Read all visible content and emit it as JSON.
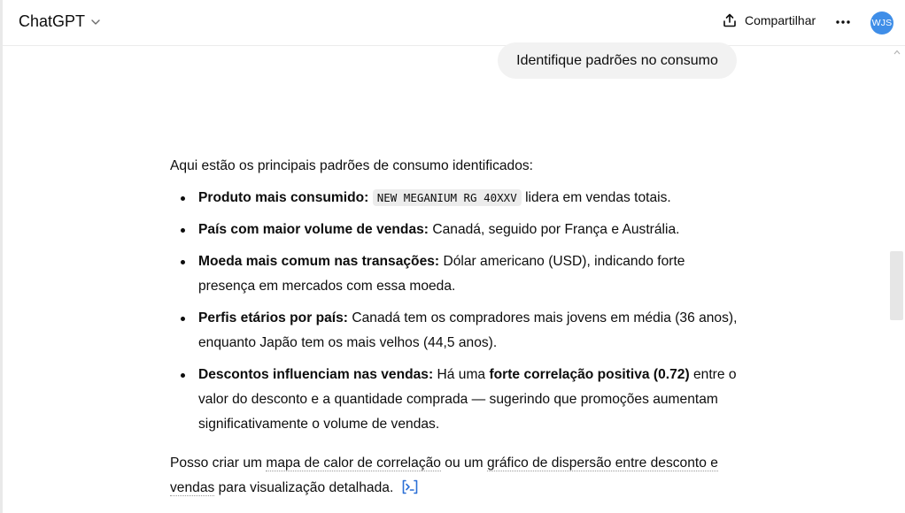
{
  "header": {
    "model_name": "ChatGPT",
    "share_label": "Compartilhar",
    "avatar_initials": "WJS",
    "avatar_color": "#3f8ee8"
  },
  "user_message": {
    "text": "Identifique padrões no consumo"
  },
  "assistant": {
    "intro": "Aqui estão os principais padrões de consumo identificados:",
    "bullets": [
      {
        "bold": "Produto mais consumido:",
        "code": "NEW MEGANIUM RG 40XXV",
        "rest": " lidera em vendas totais."
      },
      {
        "bold": "País com maior volume de vendas:",
        "rest": " Canadá, seguido por França e Austrália."
      },
      {
        "bold": "Moeda mais comum nas transações:",
        "rest": " Dólar americano (USD), indicando forte presença em mercados com essa moeda."
      },
      {
        "bold": "Perfis etários por país:",
        "rest": " Canadá tem os compradores mais jovens em média (36 anos), enquanto Japão tem os mais velhos (44,5 anos)."
      },
      {
        "bold": "Descontos influenciam nas vendas:",
        "rest_a": " Há uma ",
        "bold2": "forte correlação positiva (0.72)",
        "rest_b": " entre o valor do desconto e a quantidade comprada — sugerindo que promoções aumentam significativamente o volume de vendas."
      }
    ],
    "closing": {
      "prefix": "Posso criar um ",
      "link1": "mapa de calor de correlação",
      "middle": " ou um ",
      "link2a": "gráfico de dispersão entre desconto e",
      "link2b": "vendas",
      "suffix": " para visualização detalhada.",
      "analysis_icon": "code-interpreter-icon"
    }
  },
  "icons": {
    "model_chevron": "chevron-down-icon",
    "share": "share-icon",
    "more": "more-horizontal-icon",
    "scroll_up": "chevron-up-icon"
  },
  "colors": {
    "bubble_bg": "#f2f2f2",
    "link_accent": "#2b6fd6"
  }
}
